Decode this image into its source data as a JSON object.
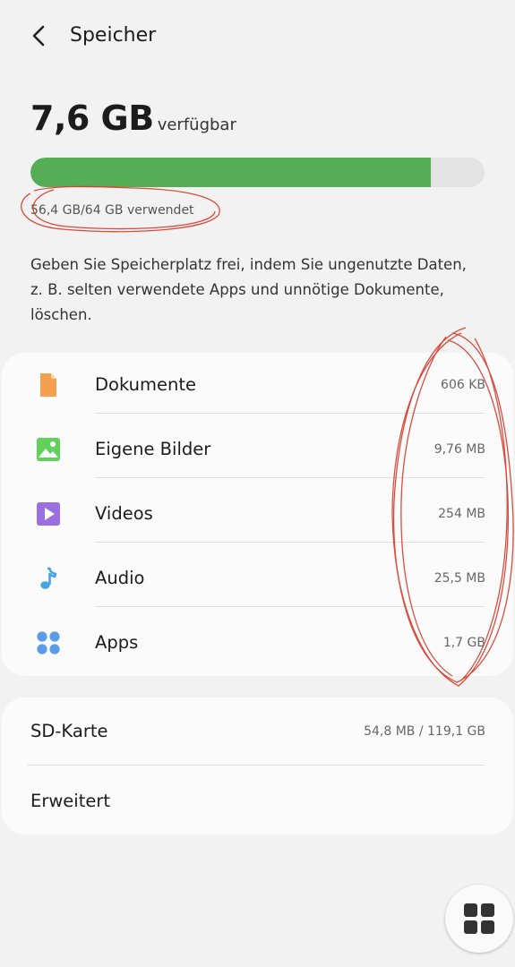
{
  "header": {
    "title": "Speicher",
    "back_icon": "back-arrow-icon"
  },
  "storage": {
    "available_value": "7,6 GB",
    "available_label": "verfügbar",
    "used_text": "56,4 GB/64 GB verwendet",
    "used_fraction": 0.881,
    "bar_color": "#55ae55"
  },
  "hint": "Geben Sie Speicherplatz frei, indem Sie ungenutzte Daten, z. B. selten verwendete Apps und unnötige Dokumente, löschen.",
  "categories": [
    {
      "label": "Dokumente",
      "size": "606 KB",
      "icon": "document-icon",
      "color": "#f5a04f"
    },
    {
      "label": "Eigene Bilder",
      "size": "9,76 MB",
      "icon": "image-icon",
      "color": "#62d15c"
    },
    {
      "label": "Videos",
      "size": "254 MB",
      "icon": "video-icon",
      "color": "#9b6fe0"
    },
    {
      "label": "Audio",
      "size": "25,5 MB",
      "icon": "music-note-icon",
      "color": "#45a3e6"
    },
    {
      "label": "Apps",
      "size": "1,7 GB",
      "icon": "apps-grid-icon",
      "color": "#5b9ce8"
    }
  ],
  "sd_card": {
    "label": "SD-Karte",
    "size": "54,8 MB / 119,1 GB"
  },
  "advanced": {
    "label": "Erweitert"
  },
  "fab": {
    "icon": "grid-view-icon"
  },
  "annotation_color": "#d63a2a"
}
